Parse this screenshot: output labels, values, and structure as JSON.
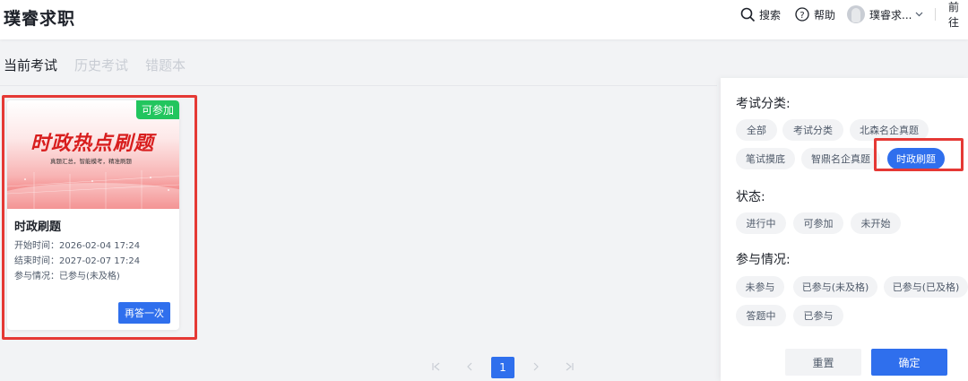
{
  "header": {
    "logo": "璞睿求职",
    "search_label": "搜索",
    "help_label": "帮助",
    "user_name": "璞睿求...",
    "goto_label": "前往"
  },
  "tabs": [
    {
      "label": "当前考试",
      "active": true
    },
    {
      "label": "历史考试",
      "active": false
    },
    {
      "label": "错题本",
      "active": false
    }
  ],
  "exam_card": {
    "banner_title": "时政热点刷题",
    "banner_subtitle": "真题汇总，智能模考，精准刷题",
    "status_badge": "可参加",
    "title": "时政刷题",
    "start_time": "开始时间：2026-02-04 17:24",
    "end_time": "结束时间：2027-02-07 17:24",
    "participation": "参与情况：已参与(未及格)",
    "retry_button": "再答一次"
  },
  "pagination": {
    "current_page": "1"
  },
  "filter": {
    "category_label": "考试分类:",
    "category_options": [
      "全部",
      "考试分类",
      "北森名企真题",
      "笔试摸底",
      "智鼎名企真题",
      "时政刷题"
    ],
    "category_selected": "时政刷题",
    "status_label": "状态:",
    "status_options": [
      "进行中",
      "可参加",
      "未开始"
    ],
    "participation_label": "参与情况:",
    "participation_options": [
      "未参与",
      "已参与(未及格)",
      "已参与(已及格)",
      "答题中",
      "已参与"
    ],
    "reset_button": "重置",
    "confirm_button": "确定"
  },
  "colors": {
    "primary": "#2f6fed",
    "success": "#22c55e",
    "highlight_frame": "#e53935"
  }
}
